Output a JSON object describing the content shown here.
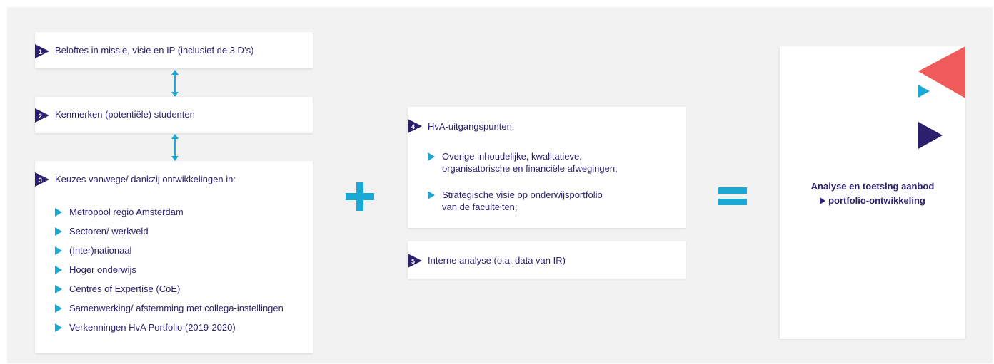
{
  "boxes": {
    "box1": {
      "number": "1",
      "label": "Beloftes in missie, visie en IP (inclusief de 3 D’s)"
    },
    "box2": {
      "number": "2",
      "label": "Kenmerken (potentiële) studenten"
    },
    "box3": {
      "number": "3",
      "label": "Keuzes vanwege/ dankzij ontwikkelingen in:",
      "items": [
        "Metropool regio Amsterdam",
        "Sectoren/ werkveld",
        "(Inter)nationaal",
        "Hoger onderwijs",
        "Centres of Expertise (CoE)",
        "Samenwerking/  afstemming met collega-instellingen",
        "Verkenningen HvA Portfolio (2019-2020)"
      ]
    },
    "box4": {
      "number": "4",
      "label": "HvA-uitgangspunten:",
      "items": [
        {
          "line1": "Overige inhoudelijke, kwalitatieve,",
          "line2": "organisatorische en financiële afwegingen;"
        },
        {
          "line1": "Strategische visie op onderwijsportfolio",
          "line2": "van de faculteiten;"
        }
      ]
    },
    "box5": {
      "number": "5",
      "label": "Interne analyse (o.a. data van IR)"
    }
  },
  "operators": {
    "plus": "+",
    "equals": "="
  },
  "result": {
    "line1": "Analyse en toetsing aanbod",
    "line2": "portfolio-ontwikkeling"
  },
  "colors": {
    "navy": "#2b1f6e",
    "cyan": "#1aa8d4",
    "coral": "#ef5a5a",
    "background": "#f2f2f2",
    "card": "#ffffff"
  }
}
